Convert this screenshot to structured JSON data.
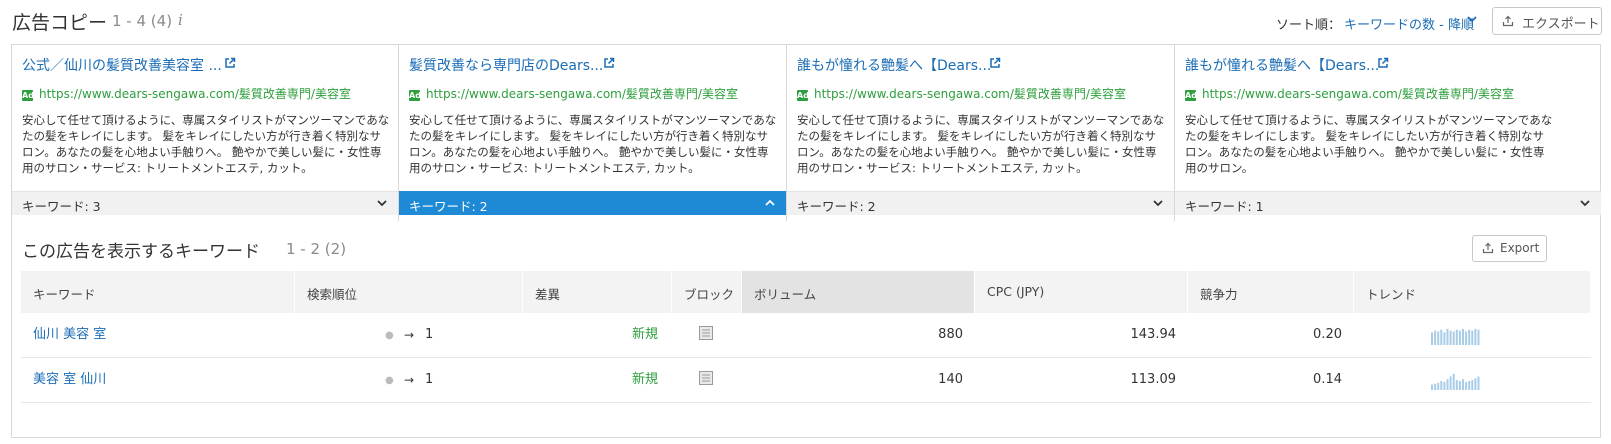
{
  "header": {
    "title": "広告コピー",
    "count": "1 - 4 (4)",
    "info_icon": "i",
    "sort_label": "ソート順：",
    "sort_value": "キーワードの数 - 降順",
    "export_label": "エクスポート"
  },
  "ads": [
    {
      "title": "公式／仙川の髪質改善美容室 ...",
      "url": "https://www.dears-sengawa.com/髪質改善専門/美容室",
      "desc": "安心して任せて頂けるように、専属スタイリストがマンツーマンであなたの髪をキレイにします。 髪をキレイにしたい方が行き着く特別なサロン。あなたの髪を心地よい手触りへ。 艶やかで美しい髪に・女性専用のサロン・サービス: トリートメントエステ, カット。",
      "keywords": "キーワード: 3",
      "active": false
    },
    {
      "title": "髪質改善なら専門店のDears...",
      "url": "https://www.dears-sengawa.com/髪質改善専門/美容室",
      "desc": "安心して任せて頂けるように、専属スタイリストがマンツーマンであなたの髪をキレイにします。 髪をキレイにしたい方が行き着く特別なサロン。あなたの髪を心地よい手触りへ。 艶やかで美しい髪に・女性専用のサロン・サービス: トリートメントエステ, カット。",
      "keywords": "キーワード: 2",
      "active": true
    },
    {
      "title": "誰もが憧れる艶髪へ【Dears...",
      "url": "https://www.dears-sengawa.com/髪質改善専門/美容室",
      "desc": "安心して任せて頂けるように、専属スタイリストがマンツーマンであなたの髪をキレイにします。 髪をキレイにしたい方が行き着く特別なサロン。あなたの髪を心地よい手触りへ。 艶やかで美しい髪に・女性専用のサロン・サービス: トリートメントエステ, カット。",
      "keywords": "キーワード: 2",
      "active": false
    },
    {
      "title": "誰もが憧れる艶髪へ【Dears...",
      "url": "https://www.dears-sengawa.com/髪質改善専門/美容室",
      "desc": "安心して任せて頂けるように、専属スタイリストがマンツーマンであなたの髪をキレイにします。 髪をキレイにしたい方が行き着く特別なサロン。あなたの髪を心地よい手触りへ。 艶やかで美しい髪に・女性専用のサロン。",
      "keywords": "キーワード: 1",
      "active": false
    }
  ],
  "ad_badge": "Ad",
  "keywords_section": {
    "title": "この広告を表示するキーワード",
    "count": "1 - 2 (2)",
    "export_label": "Export"
  },
  "table": {
    "columns": [
      "キーワード",
      "検索順位",
      "差異",
      "ブロック",
      "ボリューム",
      "CPC (JPY)",
      "競争力",
      "トレンド"
    ],
    "rows": [
      {
        "keyword": "仙川 美容 室",
        "position": "1",
        "diff": "新規",
        "volume": "880",
        "cpc": "143.94",
        "competition": "0.20",
        "trend": [
          0.7,
          0.8,
          0.75,
          0.85,
          0.7,
          0.9,
          0.8,
          0.75,
          0.85,
          0.8,
          0.9,
          0.75,
          0.85,
          0.8,
          0.9,
          0.85
        ]
      },
      {
        "keyword": "美容 室 仙川",
        "position": "1",
        "diff": "新規",
        "volume": "140",
        "cpc": "113.09",
        "competition": "0.14",
        "trend": [
          0.3,
          0.35,
          0.4,
          0.5,
          0.45,
          0.6,
          0.75,
          0.9,
          0.55,
          0.5,
          0.6,
          0.45,
          0.5,
          0.55,
          0.65,
          0.75
        ]
      }
    ]
  },
  "colors": {
    "link": "#1b6db5",
    "url_green": "#2e9e3e",
    "active_bar": "#1e8ad6",
    "trend_bar": "#a9cde8"
  },
  "icons": [
    "info-icon",
    "chevron-down-icon",
    "export-icon",
    "external-link-icon",
    "ad-badge-icon",
    "chevron-up-icon",
    "arrow-right-icon",
    "block-icon",
    "trend-sparkline"
  ]
}
